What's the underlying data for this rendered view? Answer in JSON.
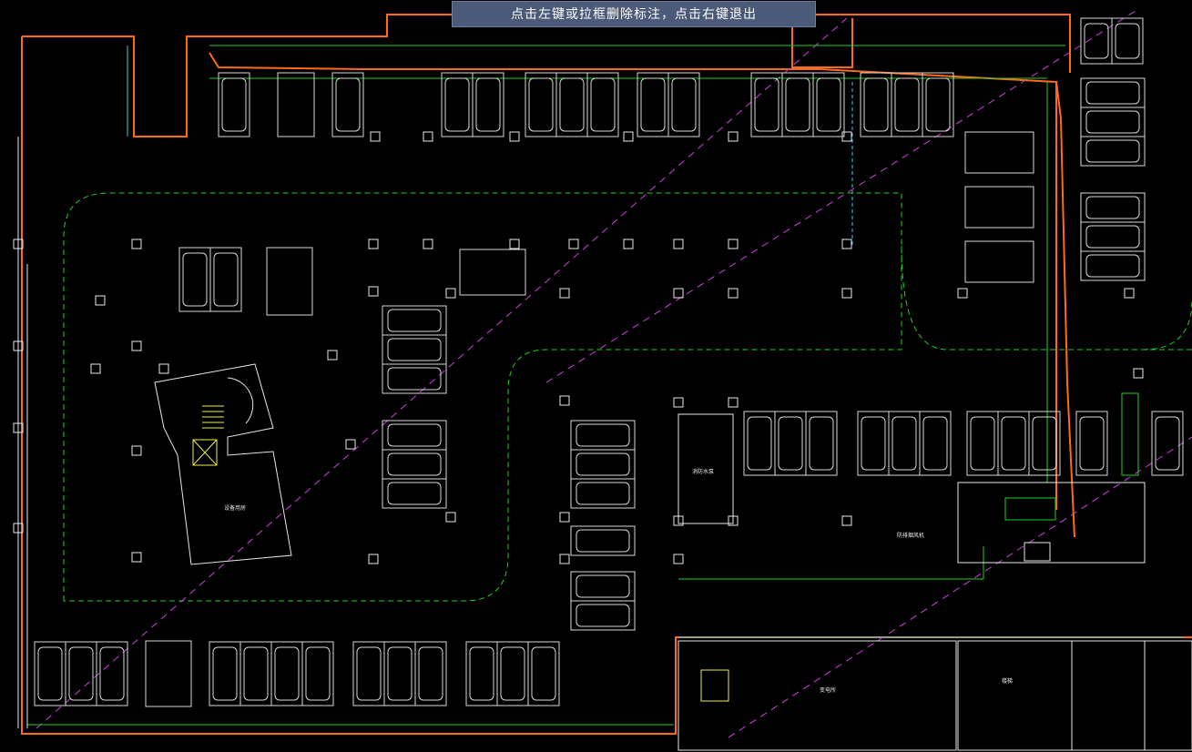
{
  "banner": {
    "hint_text": "点击左键或拉框删除标注，点击右键退出"
  },
  "colors": {
    "background": "#000000",
    "wall": "#ff6a1a",
    "structure": "#e8e8e8",
    "green_line": "#22d022",
    "magenta_dash": "#d040e0",
    "cyan": "#30d8e8",
    "yellow": "#f0f040",
    "banner_bg": "#4a5a78"
  },
  "drawing": {
    "label_rooms_left": "设备用房",
    "label_room_mid": "消防水泵",
    "label_equipment": "防排烟风机",
    "label_stairs": "楼梯",
    "label_room_bottom": "变电所"
  }
}
